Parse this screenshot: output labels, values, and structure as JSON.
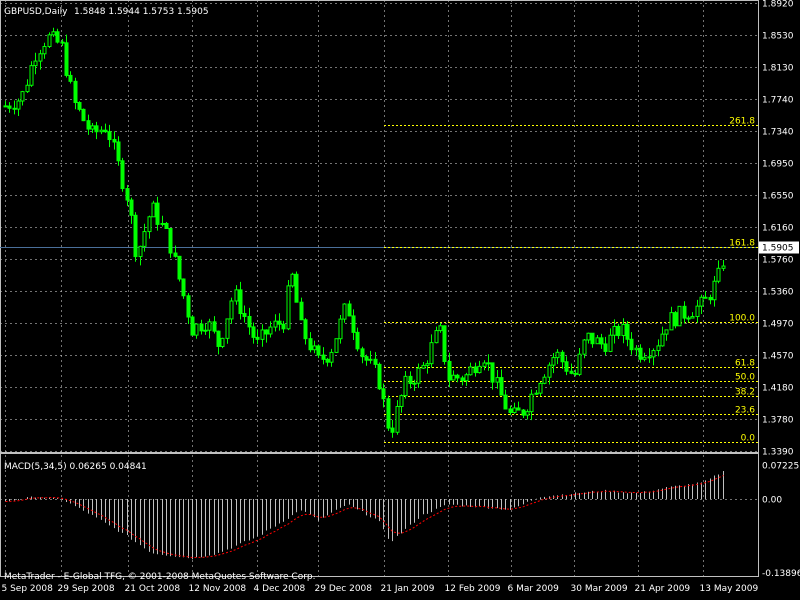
{
  "header": {
    "symbol": "GBPUSD,Daily",
    "ohlc": "1.5848 1.5944 1.5753 1.5905"
  },
  "macd_header": {
    "label": "MACD(5,34,5) 0.06265 0.04841"
  },
  "copyright": "MetaTrader - E-Global TFG, © 2001-2008 MetaQuotes Software Corp.",
  "colors": {
    "background": "#000000",
    "grid": "#c0c0c0",
    "candle": "#00ff00",
    "fib": "#ffff00",
    "macd_hist": "#c0c0c0",
    "macd_signal": "#ff0000",
    "price_line": "#4a6f9a",
    "text": "#ffffff"
  },
  "chart_data": [
    {
      "type": "candlestick",
      "title": "GBPUSD,Daily",
      "y_ticks": [
        "1.8920",
        "1.8530",
        "1.8130",
        "1.7740",
        "1.7340",
        "1.6950",
        "1.6550",
        "1.6160",
        "1.5760",
        "1.5360",
        "1.4970",
        "1.4570",
        "1.4180",
        "1.3780",
        "1.3390"
      ],
      "ylim": [
        1.339,
        1.892
      ],
      "current_price": "1.5905",
      "x_ticks": [
        "5 Sep 2008",
        "29 Sep 2008",
        "21 Oct 2008",
        "12 Nov 2008",
        "4 Dec 2008",
        "29 Dec 2008",
        "21 Jan 2009",
        "12 Feb 2009",
        "6 Mar 2009",
        "30 Mar 2009",
        "21 Apr 2009",
        "13 May 2009"
      ],
      "close_series": [
        {
          "x": "5 Sep 2008",
          "y": 1.765
        },
        {
          "x": "12 Sep 2008",
          "y": 1.775
        },
        {
          "x": "18 Sep 2008",
          "y": 1.83
        },
        {
          "x": "23 Sep 2008",
          "y": 1.85
        },
        {
          "x": "29 Sep 2008",
          "y": 1.84
        },
        {
          "x": "3 Oct 2008",
          "y": 1.77
        },
        {
          "x": "9 Oct 2008",
          "y": 1.73
        },
        {
          "x": "14 Oct 2008",
          "y": 1.74
        },
        {
          "x": "21 Oct 2008",
          "y": 1.65
        },
        {
          "x": "24 Oct 2008",
          "y": 1.58
        },
        {
          "x": "29 Oct 2008",
          "y": 1.64
        },
        {
          "x": "4 Nov 2008",
          "y": 1.6
        },
        {
          "x": "12 Nov 2008",
          "y": 1.49
        },
        {
          "x": "17 Nov 2008",
          "y": 1.5
        },
        {
          "x": "21 Nov 2008",
          "y": 1.47
        },
        {
          "x": "26 Nov 2008",
          "y": 1.535
        },
        {
          "x": "4 Dec 2008",
          "y": 1.47
        },
        {
          "x": "9 Dec 2008",
          "y": 1.49
        },
        {
          "x": "15 Dec 2008",
          "y": 1.5
        },
        {
          "x": "18 Dec 2008",
          "y": 1.56
        },
        {
          "x": "22 Dec 2008",
          "y": 1.49
        },
        {
          "x": "29 Dec 2008",
          "y": 1.45
        },
        {
          "x": "2 Jan 2009",
          "y": 1.46
        },
        {
          "x": "8 Jan 2009",
          "y": 1.52
        },
        {
          "x": "13 Jan 2009",
          "y": 1.46
        },
        {
          "x": "19 Jan 2009",
          "y": 1.43
        },
        {
          "x": "23 Jan 2009",
          "y": 1.36
        },
        {
          "x": "28 Jan 2009",
          "y": 1.42
        },
        {
          "x": "3 Feb 2009",
          "y": 1.44
        },
        {
          "x": "9 Feb 2009",
          "y": 1.49
        },
        {
          "x": "12 Feb 2009",
          "y": 1.43
        },
        {
          "x": "18 Feb 2009",
          "y": 1.43
        },
        {
          "x": "24 Feb 2009",
          "y": 1.46
        },
        {
          "x": "2 Mar 2009",
          "y": 1.41
        },
        {
          "x": "6 Mar 2009",
          "y": 1.38
        },
        {
          "x": "11 Mar 2009",
          "y": 1.39
        },
        {
          "x": "17 Mar 2009",
          "y": 1.43
        },
        {
          "x": "23 Mar 2009",
          "y": 1.46
        },
        {
          "x": "30 Mar 2009",
          "y": 1.43
        },
        {
          "x": "3 Apr 2009",
          "y": 1.48
        },
        {
          "x": "9 Apr 2009",
          "y": 1.47
        },
        {
          "x": "15 Apr 2009",
          "y": 1.49
        },
        {
          "x": "21 Apr 2009",
          "y": 1.46
        },
        {
          "x": "27 Apr 2009",
          "y": 1.47
        },
        {
          "x": "1 May 2009",
          "y": 1.5
        },
        {
          "x": "7 May 2009",
          "y": 1.51
        },
        {
          "x": "13 May 2009",
          "y": 1.52
        },
        {
          "x": "18 May 2009",
          "y": 1.55
        },
        {
          "x": "21 May 2009",
          "y": 1.5905
        }
      ],
      "fib_levels": [
        {
          "label": "261.8",
          "value": 1.742
        },
        {
          "label": "161.8",
          "value": 1.5905
        },
        {
          "label": "100.0",
          "value": 1.498
        },
        {
          "label": "61.8",
          "value": 1.443
        },
        {
          "label": "50.0",
          "value": 1.425
        },
        {
          "label": "38.2",
          "value": 1.407
        },
        {
          "label": "23.6",
          "value": 1.385
        },
        {
          "label": "0.0",
          "value": 1.35
        }
      ],
      "fib_start": "21 Jan 2009"
    },
    {
      "type": "bar",
      "title": "MACD(5,34,5) 0.06265 0.04841",
      "y_ticks": [
        "0.07225",
        "0.00",
        "-0.13896"
      ],
      "ylim": [
        -0.13896,
        0.07225
      ],
      "series": [
        {
          "x": "5 Sep 2008",
          "y": -0.005
        },
        {
          "x": "18 Sep 2008",
          "y": 0.005
        },
        {
          "x": "29 Sep 2008",
          "y": 0.0
        },
        {
          "x": "9 Oct 2008",
          "y": -0.03
        },
        {
          "x": "21 Oct 2008",
          "y": -0.07
        },
        {
          "x": "29 Oct 2008",
          "y": -0.1
        },
        {
          "x": "12 Nov 2008",
          "y": -0.11
        },
        {
          "x": "21 Nov 2008",
          "y": -0.1
        },
        {
          "x": "4 Dec 2008",
          "y": -0.07
        },
        {
          "x": "15 Dec 2008",
          "y": -0.04
        },
        {
          "x": "22 Dec 2008",
          "y": -0.02
        },
        {
          "x": "29 Dec 2008",
          "y": -0.04
        },
        {
          "x": "8 Jan 2009",
          "y": -0.01
        },
        {
          "x": "19 Jan 2009",
          "y": -0.04
        },
        {
          "x": "23 Jan 2009",
          "y": -0.08
        },
        {
          "x": "3 Feb 2009",
          "y": -0.03
        },
        {
          "x": "12 Feb 2009",
          "y": -0.01
        },
        {
          "x": "24 Feb 2009",
          "y": -0.015
        },
        {
          "x": "6 Mar 2009",
          "y": -0.02
        },
        {
          "x": "17 Mar 2009",
          "y": 0.005
        },
        {
          "x": "30 Mar 2009",
          "y": 0.012
        },
        {
          "x": "9 Apr 2009",
          "y": 0.018
        },
        {
          "x": "21 Apr 2009",
          "y": 0.012
        },
        {
          "x": "1 May 2009",
          "y": 0.025
        },
        {
          "x": "13 May 2009",
          "y": 0.035
        },
        {
          "x": "21 May 2009",
          "y": 0.06265
        }
      ],
      "signal_current": 0.04841
    }
  ]
}
